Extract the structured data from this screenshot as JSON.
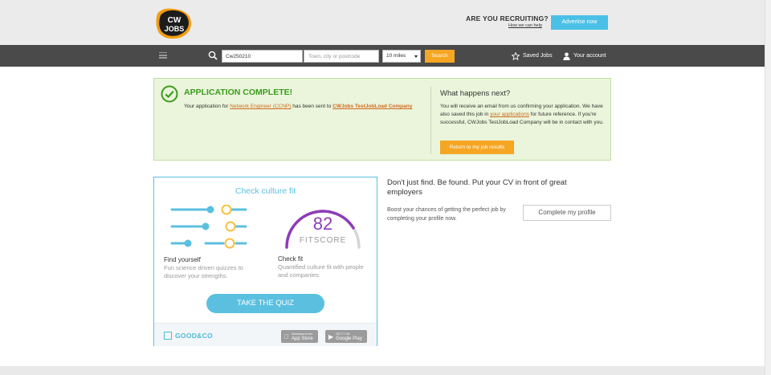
{
  "header": {
    "logo_text": "CW JOBS",
    "recruiting_label": "ARE YOU RECRUITING?",
    "how_we_help_link": "How we can help",
    "advertise_button": "Advertise now"
  },
  "nav": {
    "keyword_value": "Cw250210",
    "location_placeholder": "Town, city or postcode",
    "radius_value": "10 miles",
    "search_button": "Search",
    "saved_jobs": "Saved Jobs",
    "account": "Your account"
  },
  "application": {
    "title": "APPLICATION COMPLETE!",
    "text_prefix": "Your application for ",
    "job_link": "Network Engineer (CCNP)",
    "text_middle": " has been sent to ",
    "company_link": "CWJobs TestJobLoad Company",
    "next_title": "What happens next?",
    "next_text_1": "You will receive an email from us confirming your application. We have also saved this job in ",
    "applications_link": "your applications",
    "next_text_2": " for future reference. If you're successful, CWJobs TestJobLoad Company will be in contact with you.",
    "return_button": "Return to my job results"
  },
  "culture": {
    "title": "Check culture fit",
    "fitscore_value": "82",
    "fitscore_label": "FITSCORE",
    "fitscore_fraction": 0.82,
    "find_title": "Find yourself",
    "find_text": "Fun science driven quizzes to discover your strengths.",
    "check_title": "Check fit",
    "check_text": "Quantified culture fit with people and companies.",
    "quiz_button": "TAKE THE QUIZ",
    "brand": "GOOD&CO",
    "app_store_small": "Download on the",
    "app_store": "App Store",
    "google_play_small": "GET IT ON",
    "google_play": "Google Play"
  },
  "profile_promo": {
    "title": "Don't just find. Be found. Put your CV in front of great employers",
    "text": "Boost your chances of getting the perfect job by completing your profile now.",
    "button": "Complete my profile"
  },
  "colors": {
    "accent_orange": "#f5a623",
    "accent_blue": "#5bc0e0",
    "success_green": "#3b9b1d",
    "gauge_purple": "#8e3bb8"
  }
}
